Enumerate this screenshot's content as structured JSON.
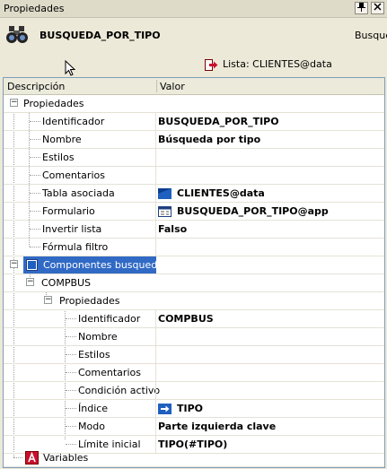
{
  "window": {
    "title": "Propiedades"
  },
  "header": {
    "object_name": "BUSQUEDA_POR_TIPO",
    "object_type": "Busqueda",
    "list_link": "Lista: CLIENTES@data"
  },
  "columns": {
    "description": "Descripción",
    "value": "Valor"
  },
  "rows": {
    "propiedades": "Propiedades",
    "identificador": {
      "label": "Identificador",
      "value": "BUSQUEDA_POR_TIPO"
    },
    "nombre": {
      "label": "Nombre",
      "value": "Búsqueda por tipo"
    },
    "estilos": {
      "label": "Estilos",
      "value": ""
    },
    "comentarios": {
      "label": "Comentarios",
      "value": ""
    },
    "tabla": {
      "label": "Tabla asociada",
      "value": "CLIENTES@data"
    },
    "formulario": {
      "label": "Formulario",
      "value": "BUSQUEDA_POR_TIPO@app"
    },
    "invertir": {
      "label": "Invertir lista",
      "value": "Falso"
    },
    "formula": {
      "label": "Fórmula filtro",
      "value": ""
    },
    "componentes": "Componentes busqueda",
    "compbus": "COMPBUS",
    "c_propiedades": "Propiedades",
    "c_identificador": {
      "label": "Identificador",
      "value": "COMPBUS"
    },
    "c_nombre": {
      "label": "Nombre",
      "value": ""
    },
    "c_estilos": {
      "label": "Estilos",
      "value": ""
    },
    "c_comentarios": {
      "label": "Comentarios",
      "value": ""
    },
    "c_condicion": {
      "label": "Condición activo",
      "value": ""
    },
    "c_indice": {
      "label": "Índice",
      "value": "TIPO"
    },
    "c_modo": {
      "label": "Modo",
      "value": "Parte izquierda clave"
    },
    "c_limite": {
      "label": "Límite inicial",
      "value": "TIPO(#TIPO)"
    },
    "variables": "Variables"
  },
  "toggles": {
    "expanded": "−"
  },
  "colors": {
    "selection": "#316ac5",
    "panel": "#ece9d8",
    "accent_red": "#c8102e"
  }
}
